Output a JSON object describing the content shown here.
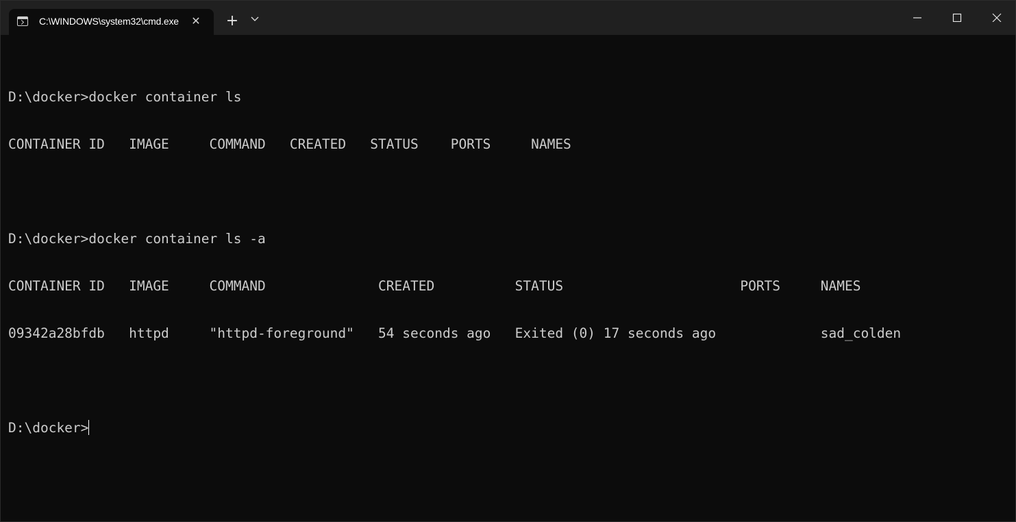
{
  "window": {
    "tab_title": "C:\\WINDOWS\\system32\\cmd.exe",
    "tab_close": "✕",
    "new_tab": "+",
    "icons": {
      "tab": "terminal-icon",
      "dropdown": "chevron-down-icon",
      "minimize": "minimize-icon",
      "maximize": "maximize-icon",
      "close": "close-icon"
    }
  },
  "terminal": {
    "lines": [
      "",
      "D:\\docker>docker container ls",
      "CONTAINER ID   IMAGE     COMMAND   CREATED   STATUS    PORTS     NAMES",
      "",
      "D:\\docker>docker container ls -a",
      "CONTAINER ID   IMAGE     COMMAND              CREATED          STATUS                      PORTS     NAMES",
      "09342a28bfdb   httpd     \"httpd-foreground\"   54 seconds ago   Exited (0) 17 seconds ago             sad_colden",
      "",
      "D:\\docker>"
    ]
  }
}
